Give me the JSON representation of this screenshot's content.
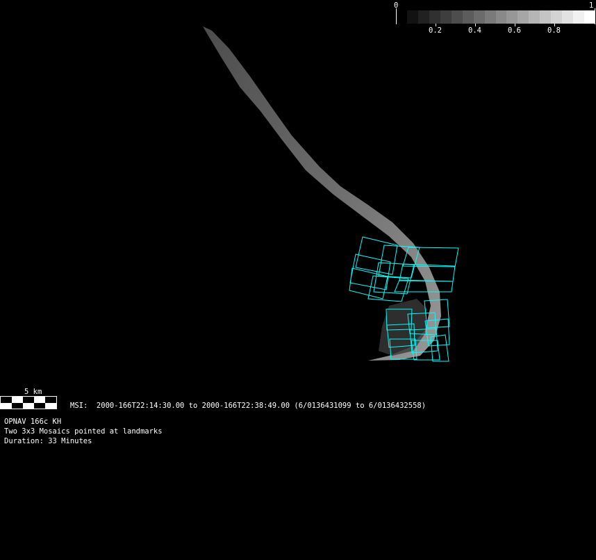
{
  "colorbar": {
    "min_label": "0",
    "max_label": "1",
    "tick_labels": [
      "0.2",
      "0.4",
      "0.6",
      "0.8"
    ],
    "tick_values": [
      0.2,
      0.4,
      0.6,
      0.8
    ],
    "levels": 17
  },
  "scale_bar": {
    "label": "5 km"
  },
  "observation": {
    "timespan": "MSI:  2000-166T22:14:30.00 to 2000-166T22:38:49.00 (6/0136431099 to 6/0136432558)",
    "title": "OPNAV 166c KH",
    "description": "Two 3x3 Mosaics pointed at landmarks",
    "duration": "Duration: 33 Minutes"
  },
  "footprint_color": "#00ffff"
}
